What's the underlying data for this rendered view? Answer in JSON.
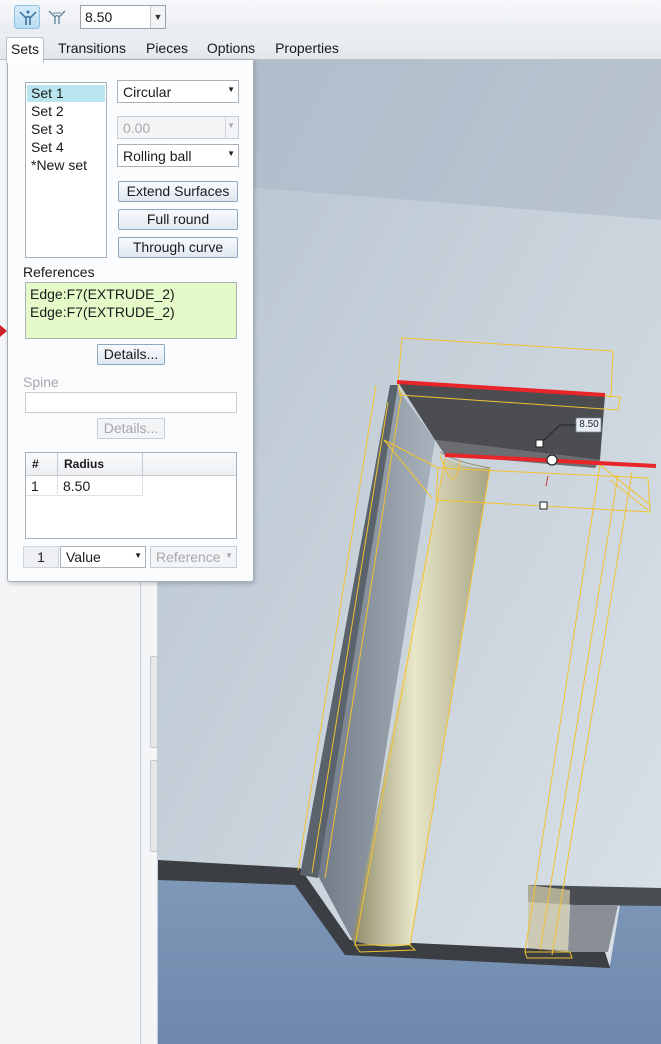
{
  "toolbar": {
    "icons": [
      "round-set-mode-icon",
      "transition-mode-icon"
    ],
    "radius_value": "8.50"
  },
  "tabs": [
    {
      "label": "Sets",
      "active": true
    },
    {
      "label": "Transitions"
    },
    {
      "label": "Pieces"
    },
    {
      "label": "Options"
    },
    {
      "label": "Properties"
    }
  ],
  "sets_panel": {
    "sets": [
      "Set 1",
      "Set 2",
      "Set 3",
      "Set 4",
      "*New set"
    ],
    "selected_set": "Set 1",
    "cross_section": "Circular",
    "conic_value": "0.00",
    "method": "Rolling ball",
    "buttons": {
      "extend_surfaces": "Extend Surfaces",
      "full_round": "Full round",
      "through_curve": "Through curve"
    },
    "references_label": "References",
    "references": [
      "Edge:F7(EXTRUDE_2)",
      "Edge:F7(EXTRUDE_2)"
    ],
    "details_label": "Details...",
    "spine_label": "Spine",
    "spine_details_label": "Details...",
    "radius_table": {
      "headers": [
        "#",
        "Radius"
      ],
      "rows": [
        [
          "1",
          "8.50"
        ]
      ]
    },
    "row_index": "1",
    "value_mode": "Value",
    "reference_mode": "Reference"
  },
  "viewport": {
    "dimension_label": "8.50"
  },
  "colors": {
    "preview_outline": "#f2c230",
    "selected_edge": "#e8262a",
    "reference_box": "#e4fbc9",
    "selected_set": "#b9e6ee"
  }
}
